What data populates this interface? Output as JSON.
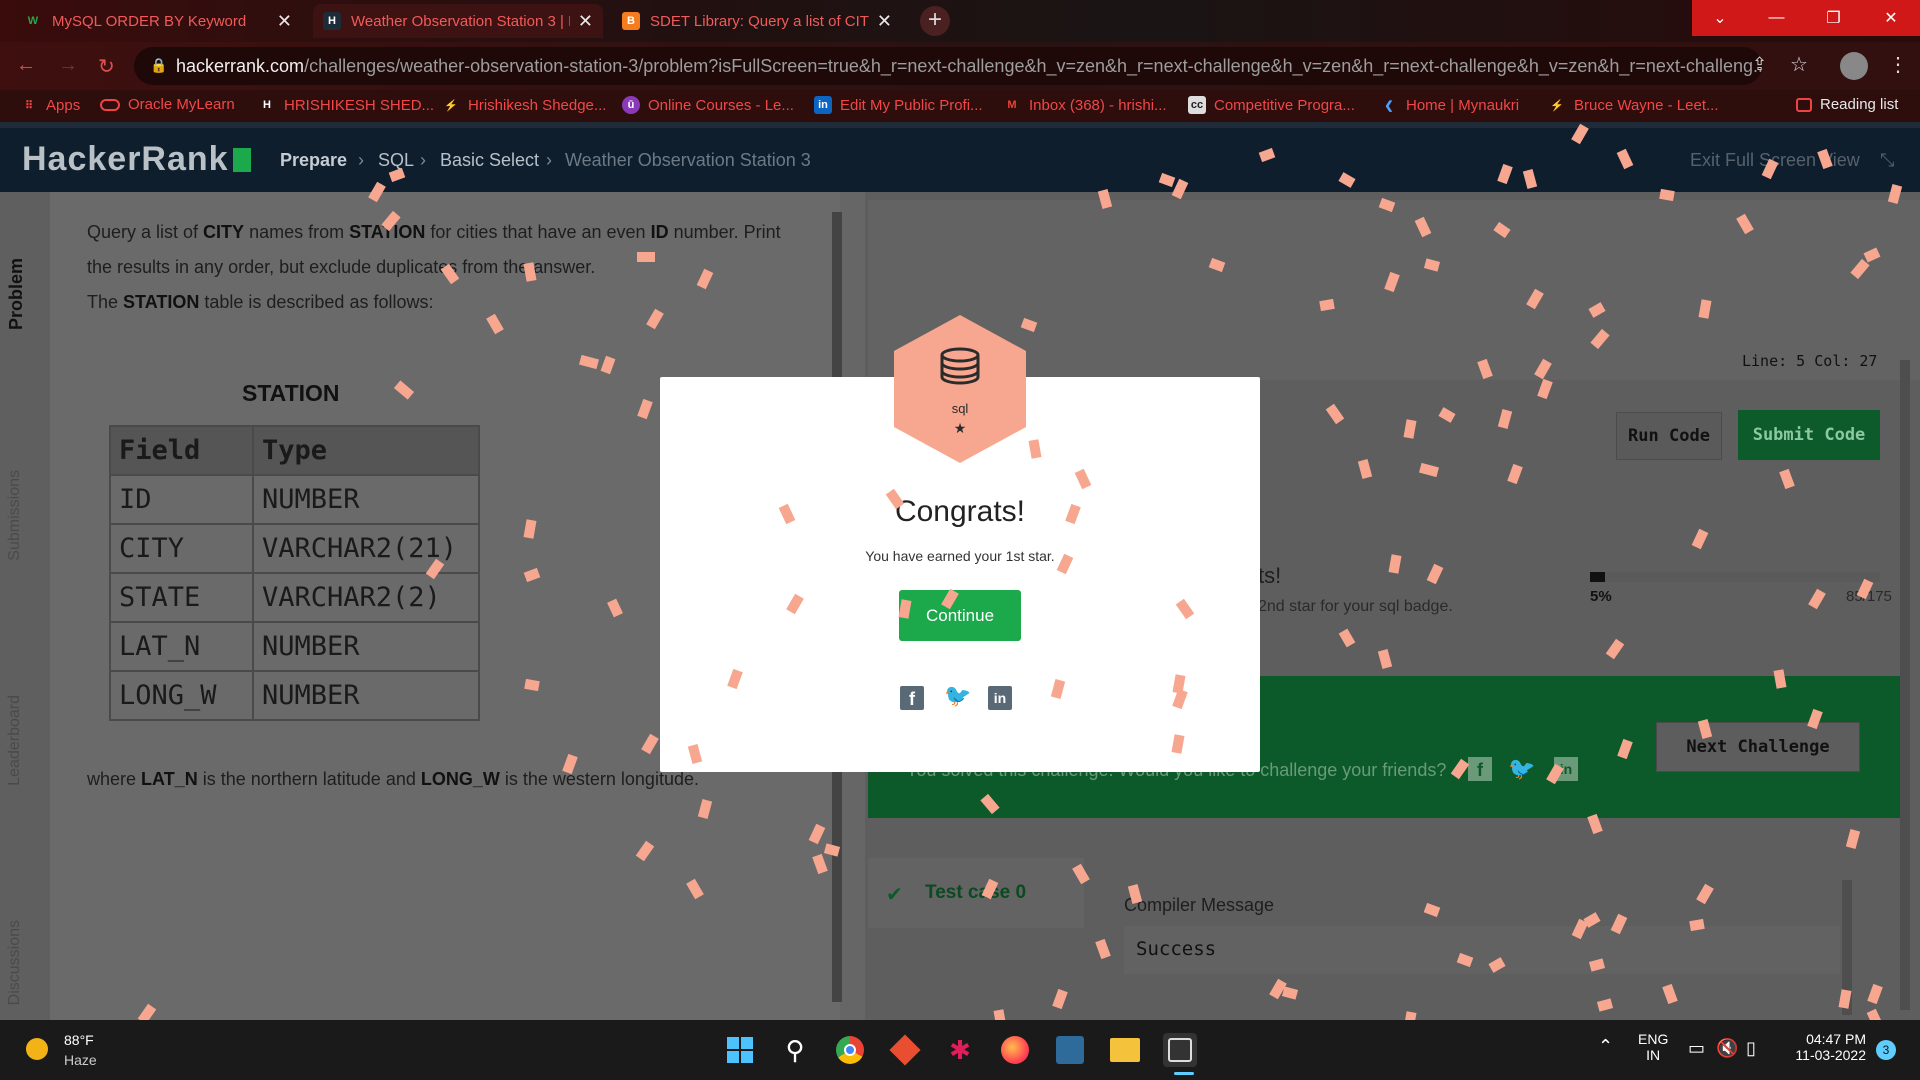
{
  "tabs": [
    {
      "title": "MySQL ORDER BY Keyword",
      "favicon": "W"
    },
    {
      "title": "Weather Observation Station 3 | H",
      "favicon": "H"
    },
    {
      "title": "SDET Library: Query a list of CITY",
      "favicon": "B"
    }
  ],
  "address": {
    "domain": "hackerrank.com",
    "path": "/challenges/weather-observation-station-3/problem?isFullScreen=true&h_r=next-challenge&h_v=zen&h_r=next-challenge&h_v=zen&h_r=next-challenge&h_v=zen&h_r=next-challeng..."
  },
  "bookmarks": [
    "Apps",
    "Oracle MyLearn",
    "HRISHIKESH SHED...",
    "Hrishikesh Shedge...",
    "Online Courses - Le...",
    "Edit My Public Profi...",
    "Inbox (368) - hrishi...",
    "Competitive Progra...",
    "Home | Mynaukri",
    "Bruce Wayne - Leet..."
  ],
  "reading_list": "Reading list",
  "header": {
    "logo": "HackerRank",
    "crumbs": [
      "Prepare",
      "SQL",
      "Basic Select",
      "Weather Observation Station 3"
    ],
    "exit": "Exit Full Screen View"
  },
  "sidenav": [
    "Problem",
    "Submissions",
    "Leaderboard",
    "Discussions"
  ],
  "problem": {
    "line1a": "Query a list of ",
    "city": "CITY",
    "line1b": " names from ",
    "station": "STATION",
    "line1c": " for cities that have an even ",
    "id": "ID",
    "line1d": " number. Print",
    "line2": "the results in any order, but exclude duplicates from the answer.",
    "line3a": "The ",
    "line3b": " table is described as follows:",
    "table_title": "STATION",
    "columns": [
      "Field",
      "Type"
    ],
    "rows": [
      [
        "ID",
        "NUMBER"
      ],
      [
        "CITY",
        "VARCHAR2(21)"
      ],
      [
        "STATE",
        "VARCHAR2(2)"
      ],
      [
        "LAT_N",
        "NUMBER"
      ],
      [
        "LONG_W",
        "NUMBER"
      ]
    ],
    "where_a": "where ",
    "lat": "LAT_N",
    "where_b": " is the northern latitude and ",
    "long": "LONG_W",
    "where_c": " is the western longitude."
  },
  "editor": {
    "status": "Line: 5 Col: 27",
    "run": "Run Code",
    "submit": "Submit Code",
    "points_title": "ts!",
    "points_sub": "2nd star for your sql badge.",
    "progress_label": "5%",
    "progress_fraction": 0.05,
    "progress_count": "85/175",
    "solved_text": "You solved this challenge. Would you like to challenge your friends?",
    "next": "Next Challenge",
    "testcase": "Test case 0",
    "compiler_label": "Compiler Message",
    "compiler_value": "Success"
  },
  "modal": {
    "badge_text": "sql",
    "title": "Congrats!",
    "sub": "You have earned your 1st star.",
    "button": "Continue"
  },
  "taskbar": {
    "temp": "88°F",
    "weather": "Haze",
    "lang1": "ENG",
    "lang2": "IN",
    "time": "04:47 PM",
    "date": "11-03-2022",
    "notif": "3"
  },
  "colors": {
    "brand_green": "#1ba94c",
    "confetti": "#f7a78f",
    "tab_red": "#f15a5a"
  }
}
